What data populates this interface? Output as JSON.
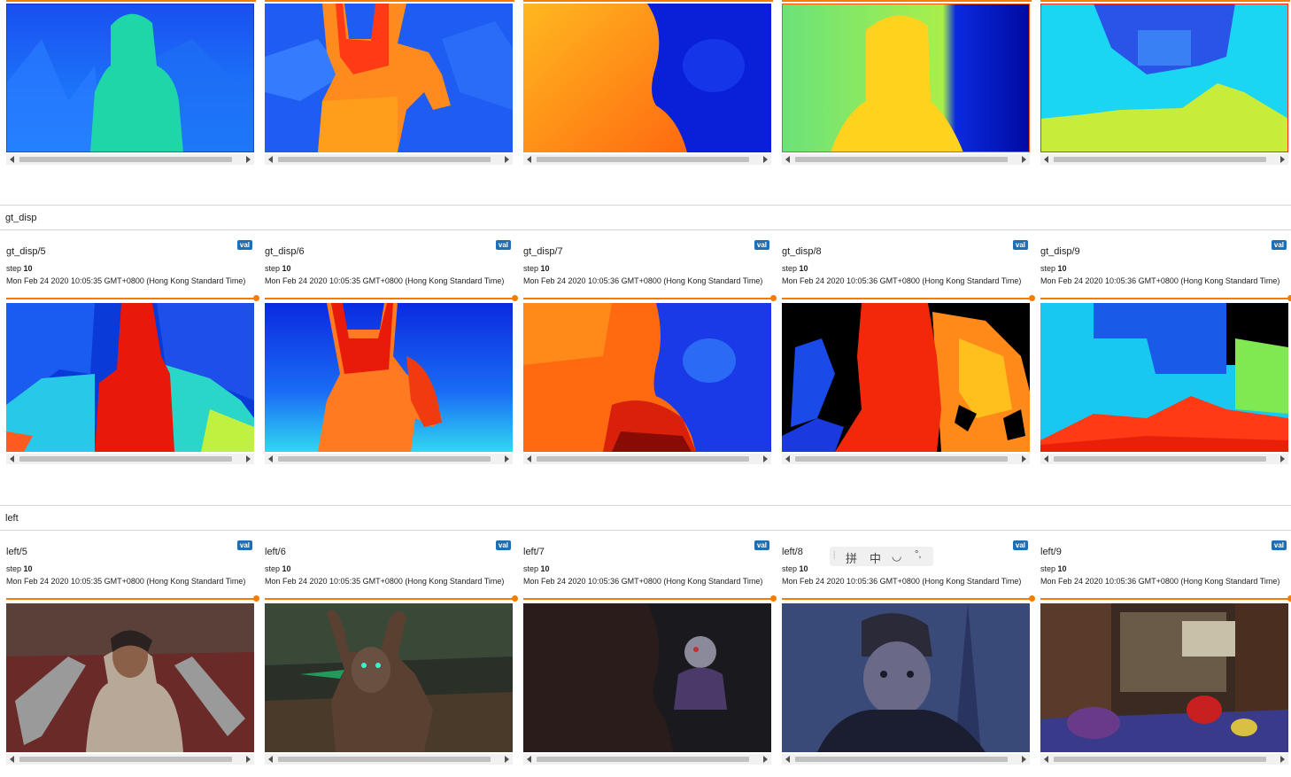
{
  "sections": [
    {
      "name": "",
      "cards": [
        {
          "tag": "",
          "badge": "",
          "step_label": "",
          "step": "",
          "timestamp": "",
          "image_kind": "pred-5"
        },
        {
          "tag": "",
          "badge": "",
          "step_label": "",
          "step": "",
          "timestamp": "",
          "image_kind": "pred-6"
        },
        {
          "tag": "",
          "badge": "",
          "step_label": "",
          "step": "",
          "timestamp": "",
          "image_kind": "pred-7"
        },
        {
          "tag": "",
          "badge": "",
          "step_label": "",
          "step": "",
          "timestamp": "",
          "image_kind": "pred-8"
        },
        {
          "tag": "",
          "badge": "",
          "step_label": "",
          "step": "",
          "timestamp": "",
          "image_kind": "pred-9"
        }
      ]
    },
    {
      "name": "gt_disp",
      "cards": [
        {
          "tag": "gt_disp/5",
          "badge": "val",
          "step_label": "step",
          "step": "10",
          "timestamp": "Mon Feb 24 2020 10:05:35 GMT+0800 (Hong Kong Standard Time)",
          "image_kind": "gt-5"
        },
        {
          "tag": "gt_disp/6",
          "badge": "val",
          "step_label": "step",
          "step": "10",
          "timestamp": "Mon Feb 24 2020 10:05:35 GMT+0800 (Hong Kong Standard Time)",
          "image_kind": "gt-6"
        },
        {
          "tag": "gt_disp/7",
          "badge": "val",
          "step_label": "step",
          "step": "10",
          "timestamp": "Mon Feb 24 2020 10:05:36 GMT+0800 (Hong Kong Standard Time)",
          "image_kind": "gt-7"
        },
        {
          "tag": "gt_disp/8",
          "badge": "val",
          "step_label": "step",
          "step": "10",
          "timestamp": "Mon Feb 24 2020 10:05:36 GMT+0800 (Hong Kong Standard Time)",
          "image_kind": "gt-8"
        },
        {
          "tag": "gt_disp/9",
          "badge": "val",
          "step_label": "step",
          "step": "10",
          "timestamp": "Mon Feb 24 2020 10:05:36 GMT+0800 (Hong Kong Standard Time)",
          "image_kind": "gt-9"
        }
      ]
    },
    {
      "name": "left",
      "cards": [
        {
          "tag": "left/5",
          "badge": "val",
          "step_label": "step",
          "step": "10",
          "timestamp": "Mon Feb 24 2020 10:05:35 GMT+0800 (Hong Kong Standard Time)",
          "image_kind": "left-5"
        },
        {
          "tag": "left/6",
          "badge": "val",
          "step_label": "step",
          "step": "10",
          "timestamp": "Mon Feb 24 2020 10:05:35 GMT+0800 (Hong Kong Standard Time)",
          "image_kind": "left-6"
        },
        {
          "tag": "left/7",
          "badge": "val",
          "step_label": "step",
          "step": "10",
          "timestamp": "Mon Feb 24 2020 10:05:36 GMT+0800 (Hong Kong Standard Time)",
          "image_kind": "left-7"
        },
        {
          "tag": "left/8",
          "badge": "val",
          "step_label": "step",
          "step": "10",
          "timestamp": "Mon Feb 24 2020 10:05:36 GMT+0800 (Hong Kong Standard Time)",
          "image_kind": "left-8"
        },
        {
          "tag": "left/9",
          "badge": "val",
          "step_label": "step",
          "step": "10",
          "timestamp": "Mon Feb 24 2020 10:05:36 GMT+0800 (Hong Kong Standard Time)",
          "image_kind": "left-9"
        }
      ]
    }
  ],
  "ime_toolbar": {
    "items": [
      "拼",
      "中",
      "◡",
      "°,"
    ]
  },
  "colors": {
    "accent": "#f57c00",
    "badge": "#1e6fb6",
    "divider": "#d6d6d6"
  }
}
